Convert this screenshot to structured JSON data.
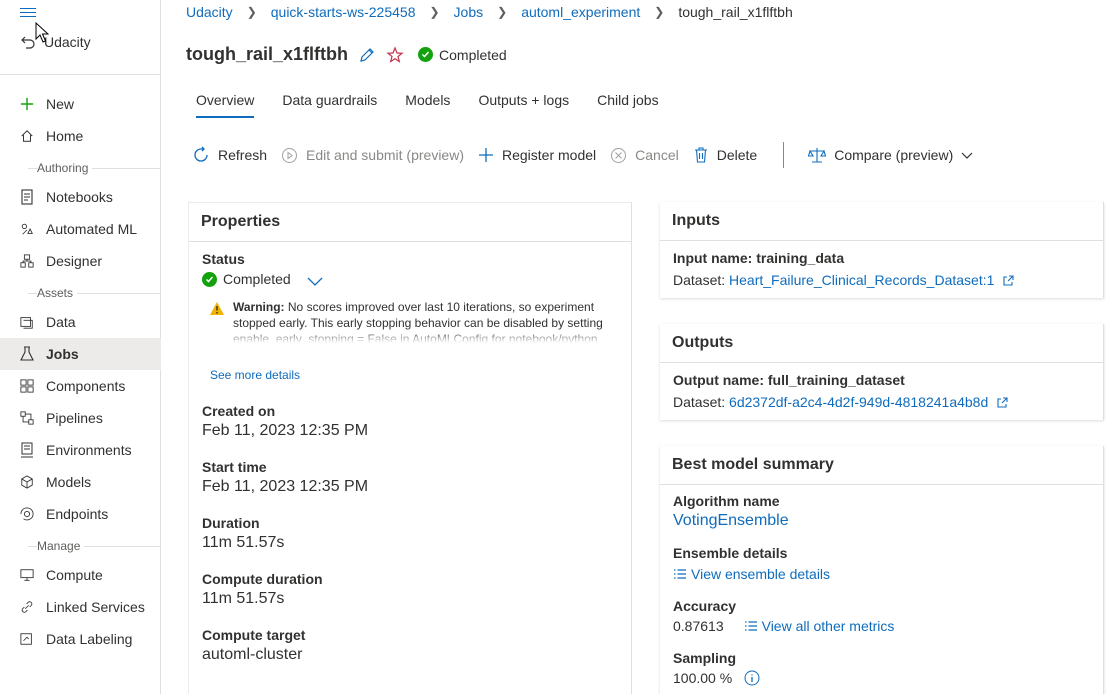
{
  "sidebar": {
    "workspace": "Udacity",
    "items": [
      {
        "label": "New",
        "icon": "plus-icon"
      },
      {
        "label": "Home",
        "icon": "home-icon"
      }
    ],
    "authoring_label": "Authoring",
    "authoring": [
      {
        "label": "Notebooks",
        "icon": "notebook-icon"
      },
      {
        "label": "Automated ML",
        "icon": "automl-icon"
      },
      {
        "label": "Designer",
        "icon": "designer-icon"
      }
    ],
    "assets_label": "Assets",
    "assets": [
      {
        "label": "Data",
        "icon": "data-icon"
      },
      {
        "label": "Jobs",
        "icon": "flask-icon"
      },
      {
        "label": "Components",
        "icon": "components-icon"
      },
      {
        "label": "Pipelines",
        "icon": "pipelines-icon"
      },
      {
        "label": "Environments",
        "icon": "environments-icon"
      },
      {
        "label": "Models",
        "icon": "cube-icon"
      },
      {
        "label": "Endpoints",
        "icon": "endpoints-icon"
      }
    ],
    "manage_label": "Manage",
    "manage": [
      {
        "label": "Compute",
        "icon": "monitor-icon"
      },
      {
        "label": "Linked Services",
        "icon": "link-icon"
      },
      {
        "label": "Data Labeling",
        "icon": "label-icon"
      }
    ]
  },
  "breadcrumb": [
    "Udacity",
    "quick-starts-ws-225458",
    "Jobs",
    "automl_experiment",
    "tough_rail_x1flftbh"
  ],
  "header": {
    "title": "tough_rail_x1flftbh",
    "status": "Completed"
  },
  "tabs": [
    "Overview",
    "Data guardrails",
    "Models",
    "Outputs + logs",
    "Child jobs"
  ],
  "toolbar": {
    "refresh": "Refresh",
    "edit_submit": "Edit and submit (preview)",
    "register_model": "Register model",
    "cancel": "Cancel",
    "delete": "Delete",
    "compare": "Compare (preview)"
  },
  "properties": {
    "heading": "Properties",
    "status_label": "Status",
    "status_value": "Completed",
    "warning_prefix": "Warning:",
    "warning_text": "No scores improved over last 10 iterations, so experiment stopped early. This early stopping behavior can be disabled by setting enable_early_stopping = False in AutoMLConfig for notebook/python",
    "see_more": "See more details",
    "created_on_label": "Created on",
    "created_on": "Feb 11, 2023 12:35 PM",
    "start_time_label": "Start time",
    "start_time": "Feb 11, 2023 12:35 PM",
    "duration_label": "Duration",
    "duration": "11m 51.57s",
    "compute_duration_label": "Compute duration",
    "compute_duration": "11m 51.57s",
    "compute_target_label": "Compute target",
    "compute_target": "automl-cluster"
  },
  "inputs": {
    "heading": "Inputs",
    "name_label": "Input name: training_data",
    "dataset_label": "Dataset:",
    "dataset_link": "Heart_Failure_Clinical_Records_Dataset:1"
  },
  "outputs": {
    "heading": "Outputs",
    "name_label": "Output name: full_training_dataset",
    "dataset_label": "Dataset:",
    "dataset_link": "6d2372df-a2c4-4d2f-949d-4818241a4b8d"
  },
  "best_model": {
    "heading": "Best model summary",
    "algorithm_label": "Algorithm name",
    "algorithm": "VotingEnsemble",
    "ensemble_label": "Ensemble details",
    "ensemble_link": "View ensemble details",
    "accuracy_label": "Accuracy",
    "accuracy": "0.87613",
    "metrics_link": "View all other metrics",
    "sampling_label": "Sampling",
    "sampling": "100.00 %"
  },
  "colors": {
    "accent": "#0f6cbd",
    "success": "#13a10e",
    "warning": "#f2b300",
    "star": "#c4314b"
  }
}
